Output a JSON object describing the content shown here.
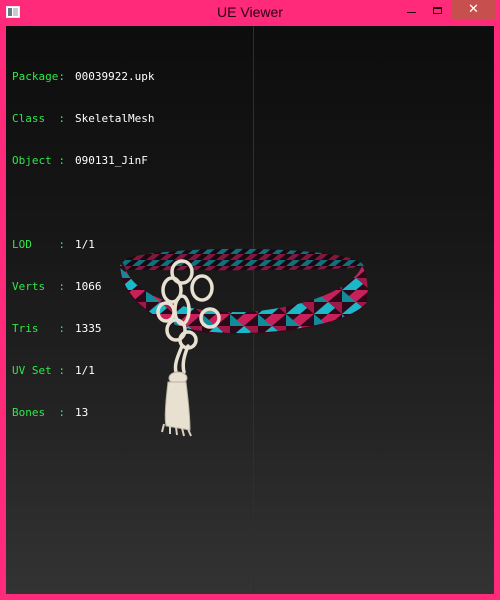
{
  "window": {
    "title": "UE Viewer",
    "accent_color": "#ff2a7a",
    "close_button_color": "#c7504f",
    "icons": {
      "app": "app-icon",
      "minimize": "minimize-icon",
      "maximize": "maximize-icon",
      "close": "close-icon"
    },
    "close_glyph": "✕"
  },
  "info": {
    "package": {
      "label": "Package:",
      "value": "00039922.upk"
    },
    "class": {
      "label": "Class  :",
      "value": "SkeletalMesh"
    },
    "object": {
      "label": "Object :",
      "value": "090131_JinF"
    },
    "lod": {
      "label": "LOD    :",
      "value": "1/1"
    },
    "verts": {
      "label": "Verts  :",
      "value": "1066"
    },
    "tris": {
      "label": "Tris   :",
      "value": "1335"
    },
    "uvset": {
      "label": "UV Set :",
      "value": "1/1"
    },
    "bones": {
      "label": "Bones  :",
      "value": "13"
    }
  },
  "colors": {
    "label_green": "#2ee84a",
    "value_white": "#ffffff",
    "axis_blue": "#1a1ad0",
    "braid_pink": "#c8205a",
    "braid_cyan": "#1ab8c8",
    "tassel_cream": "#e8e0d0"
  }
}
